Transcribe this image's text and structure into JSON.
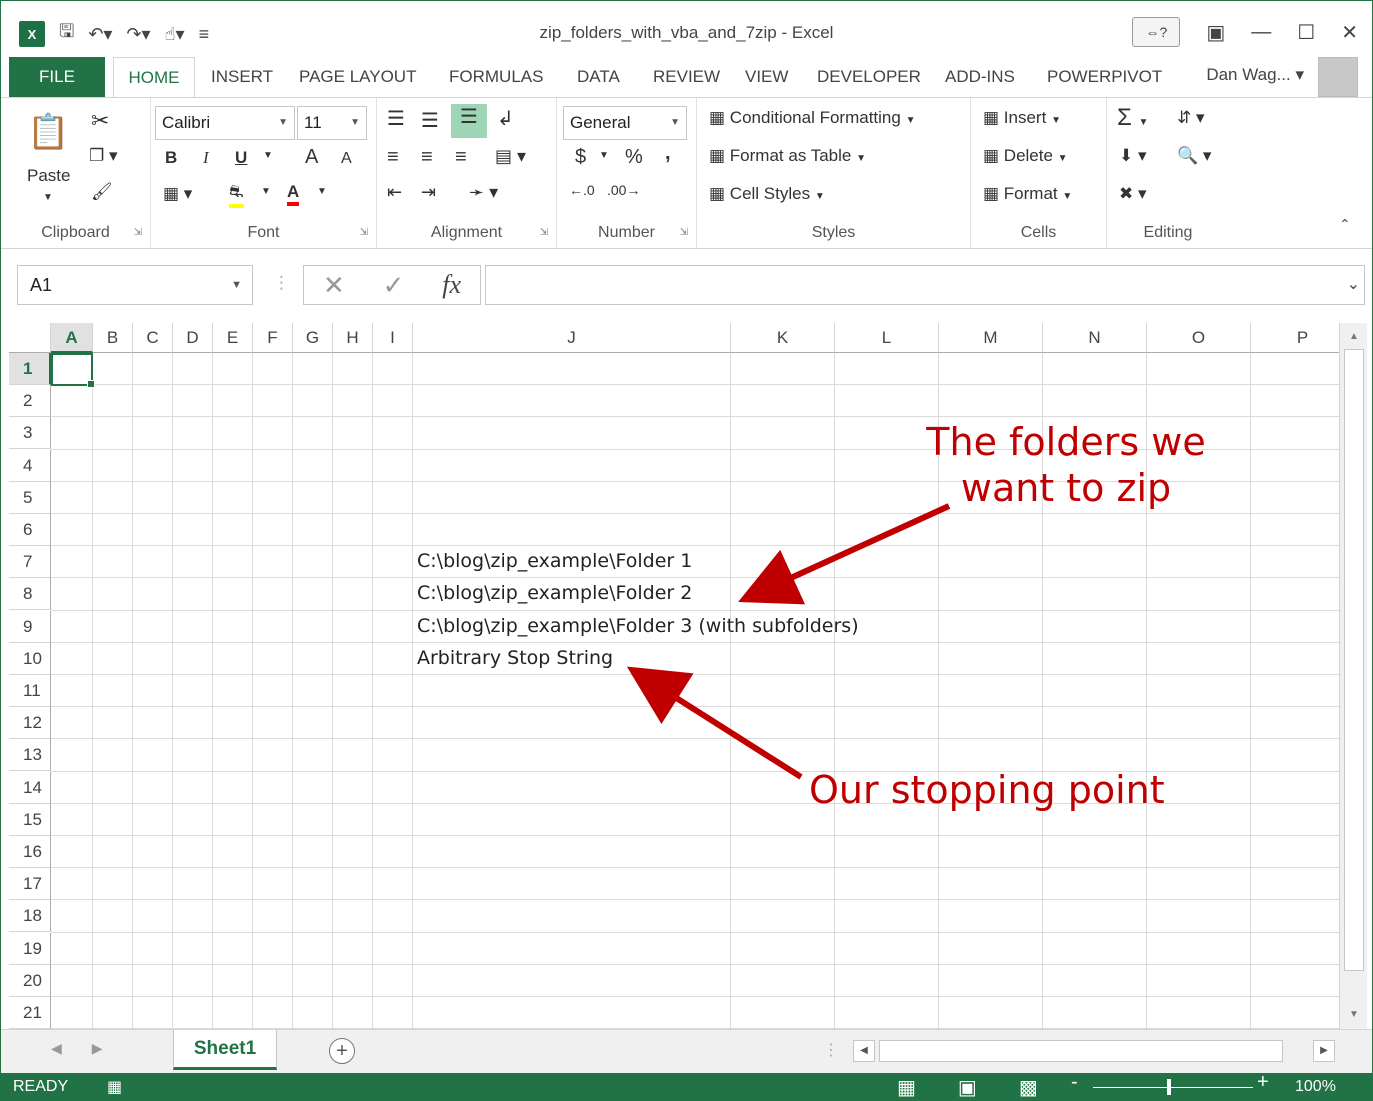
{
  "window": {
    "title": "zip_folders_with_vba_and_7zip - Excel",
    "logo": "X",
    "user": "Dan Wag...",
    "icons": [
      "save-icon",
      "undo-icon",
      "redo-icon",
      "touch-mode-icon",
      "customize-qat-icon",
      "ribbon-display-icon",
      "minimize-icon",
      "maximize-icon",
      "close-icon"
    ]
  },
  "tabs": [
    "FILE",
    "HOME",
    "INSERT",
    "PAGE LAYOUT",
    "FORMULAS",
    "DATA",
    "REVIEW",
    "VIEW",
    "DEVELOPER",
    "ADD-INS",
    "POWERPIVOT"
  ],
  "ribbon": {
    "clipboard": {
      "paste": "Paste",
      "label": "Clipboard"
    },
    "font": {
      "name": "Calibri",
      "size": "11",
      "bold": "B",
      "italic": "I",
      "underline": "U",
      "grow": "A",
      "shrink": "A",
      "fill_color": "A",
      "label": "Font"
    },
    "alignment": {
      "label": "Alignment"
    },
    "number": {
      "format": "General",
      "currency": "$",
      "percent": "%",
      "comma": ",",
      "label": "Number"
    },
    "styles": {
      "conditional": "Conditional Formatting",
      "table": "Format as Table",
      "cell_styles": "Cell Styles",
      "label": "Styles"
    },
    "cells": {
      "insert": "Insert",
      "delete": "Delete",
      "format": "Format",
      "label": "Cells"
    },
    "editing": {
      "sum": "Σ",
      "label": "Editing"
    }
  },
  "formula_bar": {
    "name_box": "A1",
    "fx": "fx",
    "value": ""
  },
  "grid": {
    "columns": [
      "A",
      "B",
      "C",
      "D",
      "E",
      "F",
      "G",
      "H",
      "I",
      "J",
      "K",
      "L",
      "M",
      "N",
      "O",
      "P"
    ],
    "rows": [
      "1",
      "2",
      "3",
      "4",
      "5",
      "6",
      "7",
      "8",
      "9",
      "10",
      "11",
      "12",
      "13",
      "14",
      "15",
      "16",
      "17",
      "18",
      "19",
      "20",
      "21"
    ],
    "active_cell": "A1",
    "cells": {
      "J7": "C:\\blog\\zip_example\\Folder 1",
      "J8": "C:\\blog\\zip_example\\Folder 2",
      "J9": "C:\\blog\\zip_example\\Folder 3 (with subfolders)",
      "J10": "Arbitrary Stop String"
    }
  },
  "annotations": {
    "folders_line1": "The folders we",
    "folders_line2": "want to zip",
    "stop": "Our stopping point",
    "color": "#c00000"
  },
  "sheets": {
    "active": "Sheet1"
  },
  "status": {
    "mode": "READY",
    "zoom": "100%"
  },
  "colors": {
    "accent": "#217346"
  }
}
